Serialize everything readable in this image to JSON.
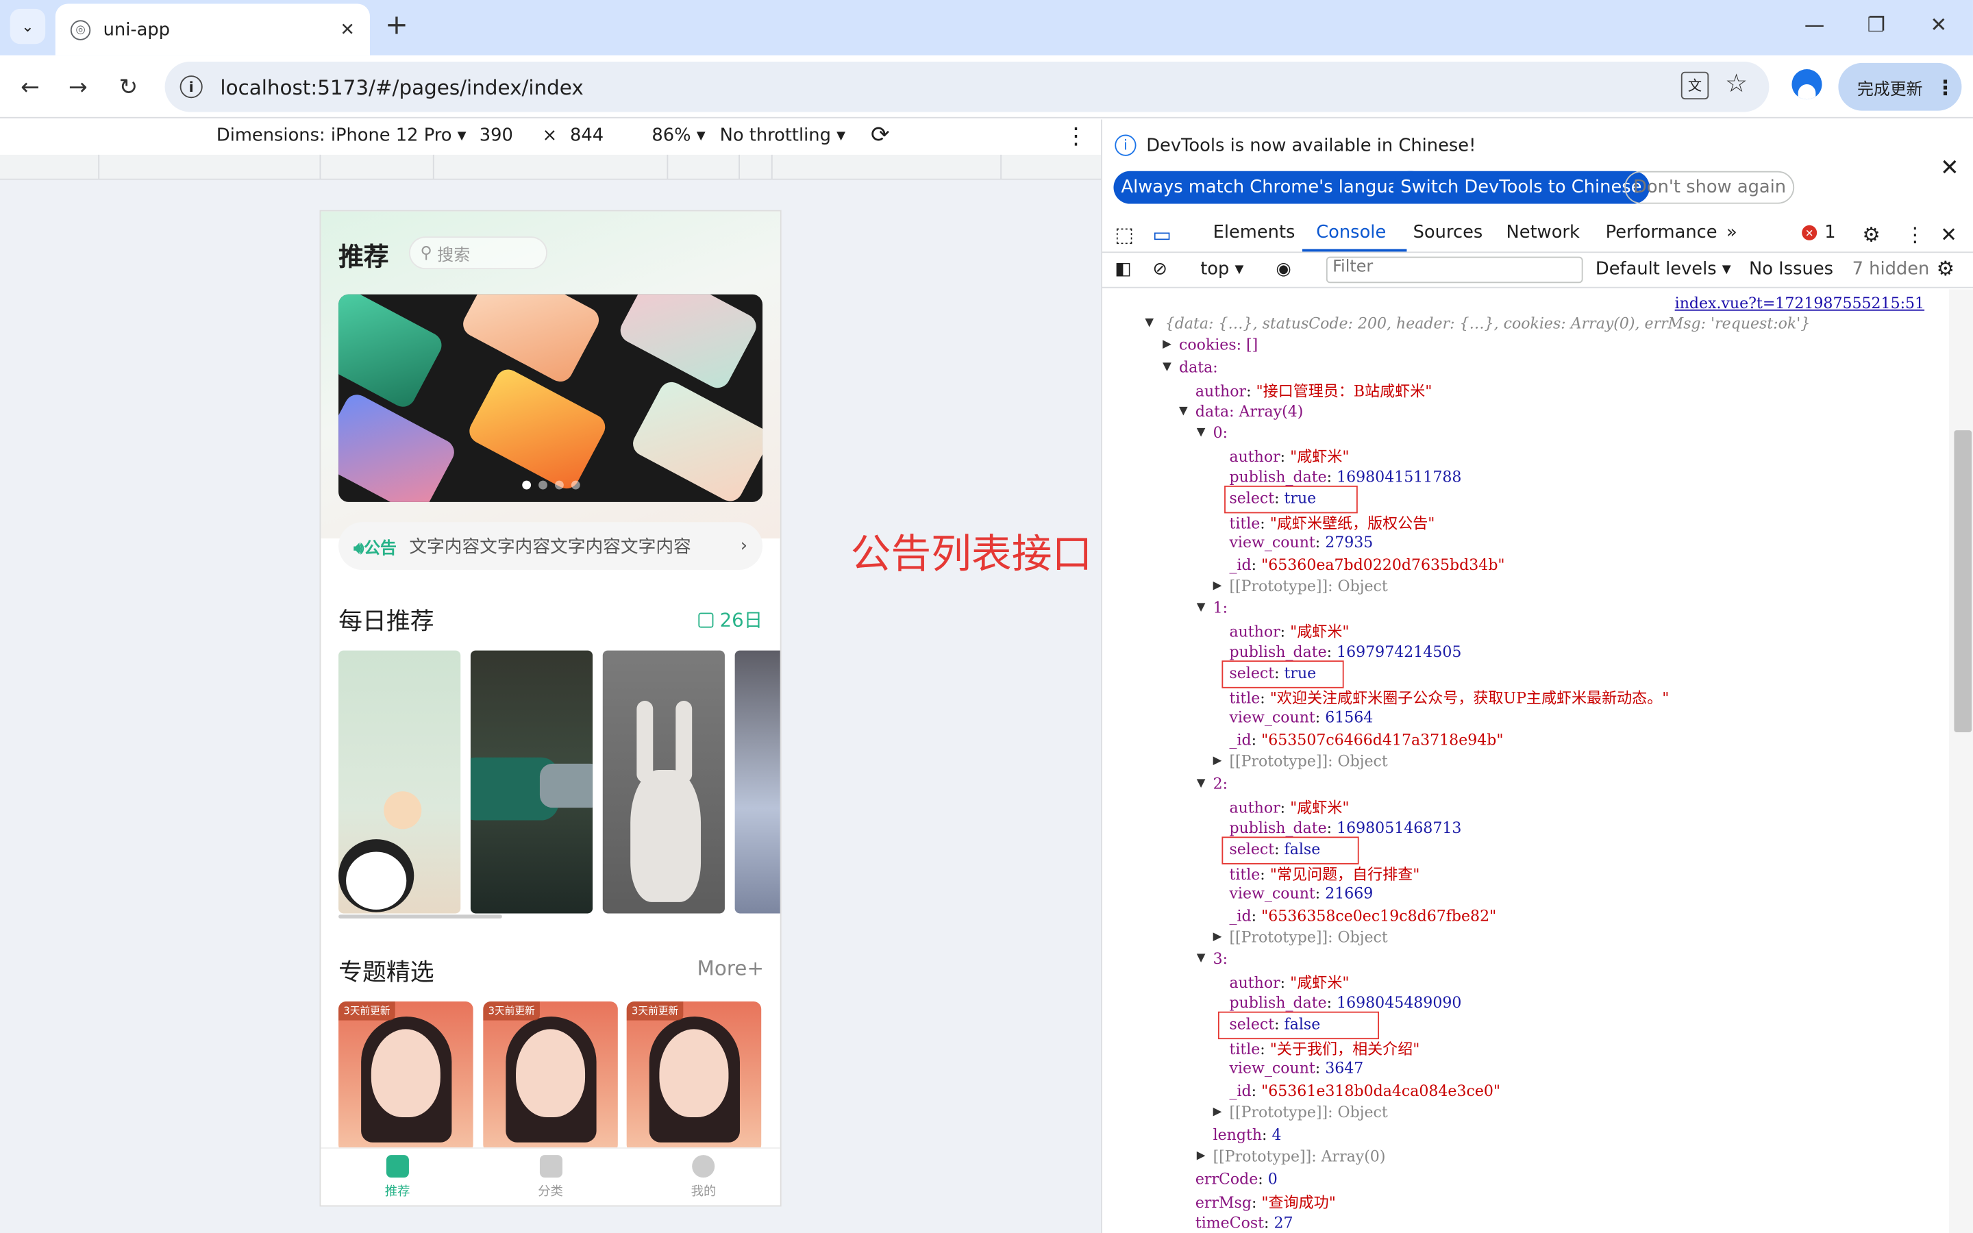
{
  "browser": {
    "tab_title": "uni-app",
    "url": "localhost:5173/#/pages/index/index",
    "update_label": "完成更新"
  },
  "device_toolbar": {
    "dimensions_label": "Dimensions: iPhone 12 Pro",
    "width": "390",
    "times": "×",
    "height": "844",
    "zoom": "86%",
    "throttling": "No throttling"
  },
  "app": {
    "header_title": "推荐",
    "search_placeholder": "搜索",
    "notice_tag": "公告",
    "notice_text": "文字内容文字内容文字内容文字内容",
    "daily_title": "每日推荐",
    "daily_date": "26日",
    "topics_title": "专题精选",
    "more_label": "More+",
    "topic_tag": "3天前更新",
    "tabbar": [
      "推荐",
      "分类",
      "我的"
    ]
  },
  "annotation": "公告列表接口",
  "devtools": {
    "info_message": "DevTools is now available in Chinese!",
    "btn_match": "Always match Chrome's language",
    "btn_switch": "Switch DevTools to Chinese",
    "btn_dont": "Don't show again",
    "tabs": [
      "Elements",
      "Console",
      "Sources",
      "Network",
      "Performance"
    ],
    "error_count": "1",
    "context": "top",
    "filter_placeholder": "Filter",
    "levels": "Default levels",
    "issues": "No Issues",
    "hidden": "7 hidden",
    "source_link": "index.vue?t=1721987555215:51"
  },
  "console": {
    "summary": "{data: {…}, statusCode: 200, header: {…}, cookies: Array(0), errMsg: 'request:ok'}",
    "cookies": "cookies: []",
    "data_key": "data:",
    "author_line": {
      "key": "author",
      "value": "\"接口管理员：B站咸虾米\""
    },
    "array_line": "data: Array(4)",
    "items": [
      {
        "index": "0:",
        "author": "\"咸虾米\"",
        "publish_date": "1698041511788",
        "select": "true",
        "title": "\"咸虾米壁纸，版权公告\"",
        "view_count": "27935",
        "id": "\"65360ea7bd0220d7635bd34b\""
      },
      {
        "index": "1:",
        "author": "\"咸虾米\"",
        "publish_date": "1697974214505",
        "select": "true",
        "title": "\"欢迎关注咸虾米圈子公众号，获取UP主咸虾米最新动态。\"",
        "view_count": "61564",
        "id": "\"653507c6466d417a3718e94b\""
      },
      {
        "index": "2:",
        "author": "\"咸虾米\"",
        "publish_date": "1698051468713",
        "select": "false",
        "title": "\"常见问题，自行排查\"",
        "view_count": "21669",
        "id": "\"6536358ce0ec19c8d67fbe82\""
      },
      {
        "index": "3:",
        "author": "\"咸虾米\"",
        "publish_date": "1698045489090",
        "select": "false",
        "title": "\"关于我们，相关介绍\"",
        "view_count": "3647",
        "id": "\"65361e318b0da4ca084e3ce0\""
      }
    ],
    "prototype_object": "[[Prototype]]: Object",
    "length": "4",
    "prototype_array": "[[Prototype]]: Array(0)",
    "err_code": "0",
    "err_msg": "\"查询成功\"",
    "time_cost": "27"
  }
}
